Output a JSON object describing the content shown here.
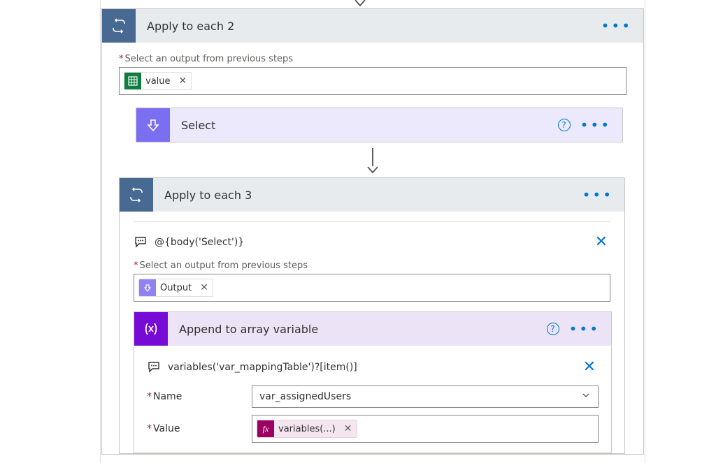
{
  "colors": {
    "loop_header_icon_bg": "#486991",
    "select_header_icon_bg": "#7a6ff0",
    "append_header_icon_bg": "#770bd6",
    "excel_token_bg": "#107c41",
    "output_token_bg": "#8f82f5",
    "fx_token_bg": "#9b0062",
    "link_blue": "#0078d4"
  },
  "apply2": {
    "title": "Apply to each 2",
    "output_label": "Select an output from previous steps",
    "token_label": "value"
  },
  "select": {
    "title": "Select"
  },
  "apply3": {
    "title": "Apply to each 3",
    "comment": "@{body('Select')}",
    "output_label": "Select an output from previous steps",
    "token_label": "Output"
  },
  "append": {
    "title": "Append to array variable",
    "comment": "variables('var_mappingTable')?[item()]",
    "name_label": "Name",
    "name_value": "var_assignedUsers",
    "value_label": "Value",
    "value_token_label": "variables(...)"
  },
  "icons": {
    "loop": "loop-icon",
    "select": "select-icon",
    "variable": "variable-icon",
    "excel": "excel-icon",
    "fx": "fx-icon",
    "comment": "comment-icon"
  }
}
